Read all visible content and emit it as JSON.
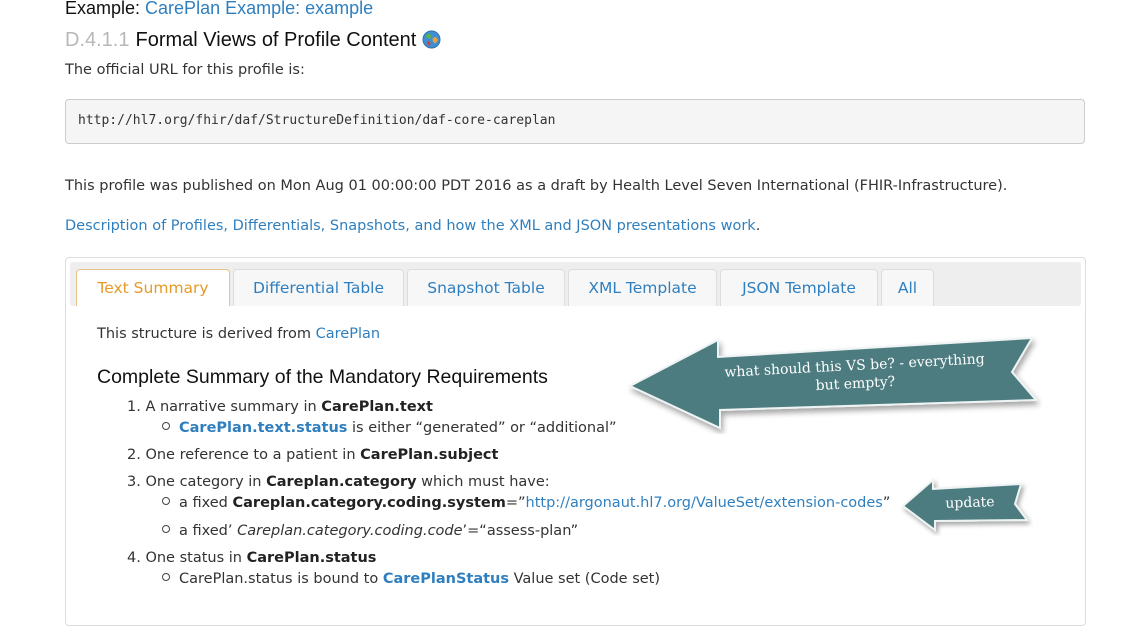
{
  "example": {
    "prefix": "Example: ",
    "link": "CarePlan Example: example"
  },
  "heading": {
    "number": "D.4.1.1",
    "title": "Formal Views of Profile Content"
  },
  "url_intro": "The official URL for this profile is:",
  "url": "http://hl7.org/fhir/daf/StructureDefinition/daf-core-careplan",
  "published": "This profile was published on Mon Aug 01 00:00:00 PDT 2016 as a draft by Health Level Seven International (FHIR-Infrastructure).",
  "description": {
    "link": "Description of Profiles, Differentials, Snapshots, and how the XML and JSON presentations work",
    "suffix": "."
  },
  "tabs": [
    {
      "label": "Text Summary",
      "active": true
    },
    {
      "label": "Differential Table"
    },
    {
      "label": "Snapshot Table"
    },
    {
      "label": "XML Template"
    },
    {
      "label": "JSON Template"
    },
    {
      "label": "All"
    }
  ],
  "derived": {
    "prefix": "This structure is derived from ",
    "link": "CarePlan"
  },
  "summary_title": "Complete Summary of the Mandatory Requirements",
  "requirements": {
    "r1": {
      "num": "1.",
      "text": "A narrative summary in ",
      "bold": "CarePlan.text"
    },
    "r1a": {
      "link": "CarePlan.text.status",
      "text": " is either “generated” or “additional”"
    },
    "r2": {
      "num": "2.",
      "text": "One reference to a patient in ",
      "bold": "CarePlan.subject"
    },
    "r3": {
      "num": "3.",
      "text": "One category in ",
      "bold": "Careplan.category",
      "suffix": " which must have:"
    },
    "r3a": {
      "text": "a fixed ",
      "bold": "Careplan.category.coding.system",
      "eq": "=”",
      "link": "http://argonaut.hl7.org/ValueSet/extension-codes",
      "close": "”"
    },
    "r3b": {
      "text": "a fixed’ ",
      "italic": "Careplan.category.coding.code",
      "rest": "’=“assess-plan”"
    },
    "r4": {
      "num": "4.",
      "text": "One status in ",
      "bold": "CarePlan.status"
    },
    "r4a": {
      "text": "CarePlan.status is bound to ",
      "link": "CarePlanStatus",
      "rest": " Value set (Code set)"
    }
  },
  "annotations": {
    "vs_line1": "what should this VS be?  - everything",
    "vs_line2": "but empty?",
    "update": "update"
  },
  "colors": {
    "link": "#2f7fbf",
    "active_tab": "#e69a28",
    "callout_fill": "#4e7b80",
    "heading_number": "#b8b8b8"
  }
}
